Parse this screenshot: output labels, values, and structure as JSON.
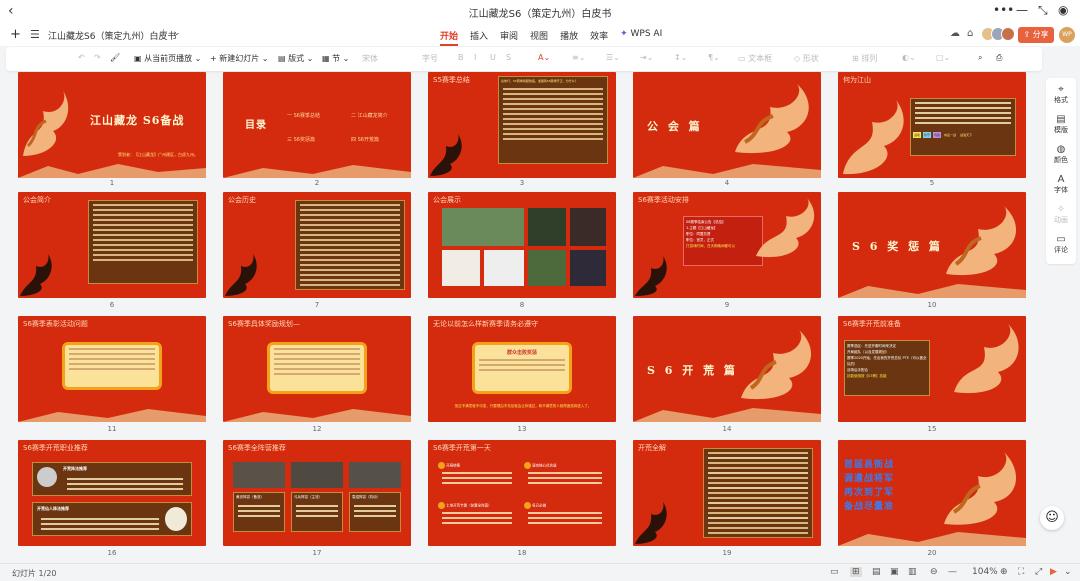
{
  "titlebar": {
    "title": "江山藏龙S6（策定九州）白皮书"
  },
  "tabbar": {
    "filename": "江山藏龙S6（策定九州）白皮书",
    "menu_tabs": [
      "开始",
      "插入",
      "审阅",
      "视图",
      "播放",
      "效率",
      "WPS AI"
    ],
    "share_label": "分享",
    "user_initials": "WP"
  },
  "toolbar": {
    "play_from_current": "从当前页播放",
    "new_slide": "新建幻灯片",
    "layout": "版式",
    "section": "节",
    "font": "宋体",
    "font_size": "字号",
    "textbox": "文本框",
    "shape": "形状",
    "arrange": "排列"
  },
  "sidebar": {
    "items": [
      {
        "label": "格式",
        "icon": "format-icon"
      },
      {
        "label": "模版",
        "icon": "template-icon"
      },
      {
        "label": "颜色",
        "icon": "palette-icon"
      },
      {
        "label": "字体",
        "icon": "font-icon"
      },
      {
        "label": "动画",
        "icon": "animation-icon"
      },
      {
        "label": "评论",
        "icon": "comment-icon"
      }
    ]
  },
  "status": {
    "slide_count": "幻灯片 1/20",
    "zoom": "104%"
  },
  "colors": {
    "accent": "#e0422a",
    "slide_red": "#d42b0e",
    "box_brown": "#6a3510",
    "gold": "#f4a21a"
  },
  "slides": [
    {
      "num": "1",
      "title": "江山藏龙  S6备战",
      "subtitle": "策划者：【江山藏龙】广州建区，白虎九州。"
    },
    {
      "num": "2",
      "title": "目录",
      "items": [
        "S6赛季总结",
        "江山藏龙简介",
        "S6奖惩篇",
        "S6开荒篇"
      ],
      "item_nums": [
        "一",
        "二",
        "三",
        "四"
      ]
    },
    {
      "num": "3",
      "header": "S5赛季总结",
      "lines": [
        "总体行，S5赛季我服较强，发展到S6赛季开正，为什么？"
      ]
    },
    {
      "num": "4",
      "title": "公 会 篇"
    },
    {
      "num": "5",
      "header": "何为江山",
      "badges": [
        "进攻",
        "防守",
        "内政",
        "群防风云",
        "向后一战",
        "战渡天下"
      ]
    },
    {
      "num": "6",
      "header": "公会简介"
    },
    {
      "num": "7",
      "header": "公会历史"
    },
    {
      "num": "8",
      "header": "公会展示"
    },
    {
      "num": "9",
      "header": "S6赛季活动安排",
      "lines": [
        "S6赛季结束公告【总结】",
        "1.主题【江山藏龙】",
        "职位：同盟总督",
        "职位：官员，正式",
        "打游戏时间，白天和晚间都可以"
      ]
    },
    {
      "num": "10",
      "title": "S 6  奖 惩 篇"
    },
    {
      "num": "11",
      "header": "S6赛季表彰活动问题"
    },
    {
      "num": "12",
      "header": "S6赛季具体奖励规划—"
    },
    {
      "num": "13",
      "header": "无论以前怎么样新赛季请务必遵守",
      "title": "群众击败奖惩",
      "footer": "放过不满意就不可变，只要理由不充足就会让你错过，和不满意的人就再度选择进入了。"
    },
    {
      "num": "14",
      "title": "S 6  开 荒 篇"
    },
    {
      "num": "15",
      "header": "S6赛季开荒前准备",
      "lines": [
        "赛季选区：先进开服时间来决定",
        "开局组队（以及发展规划）",
        "赛季2020开始，先出我的开荒总队 PTE（可以做全队的）",
        "战场后手配合",
        "技能使用按【S3等】技能"
      ]
    },
    {
      "num": "16",
      "header": "S6赛季开荒职业推荐",
      "box_titles": [
        "开荒阵法推荐",
        "开荒仙人阵法推荐"
      ]
    },
    {
      "num": "17",
      "header": "S6赛季全阵营推荐",
      "cards": [
        "黄忠阵容（备选）",
        "弓兵阵容（主流）",
        "袁绍阵容（机动）"
      ]
    },
    {
      "num": "18",
      "header": "S6赛季开荒第一天",
      "sections": [
        "开局统筹",
        "速攻核心优先级",
        "土地开荒节奏（前置全阵营）",
        "每日必做"
      ]
    },
    {
      "num": "19",
      "header": "开荒全解"
    },
    {
      "num": "20",
      "lines": [
        "首届县衙战",
        "调遣战将军",
        "再次到了军",
        "备战尽量准"
      ]
    }
  ]
}
